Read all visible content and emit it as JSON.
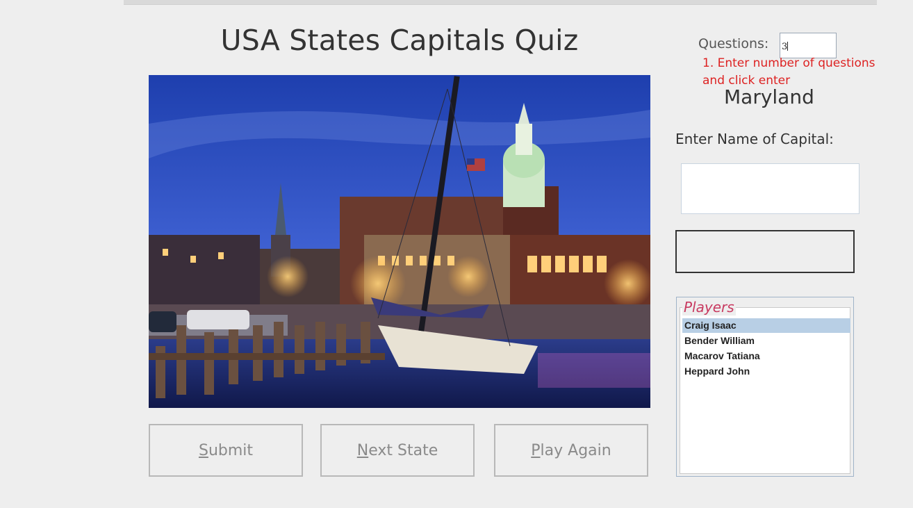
{
  "window": {
    "title": "USA States Capitals Quiz"
  },
  "questions": {
    "label": "Questions:",
    "value": "3"
  },
  "hint": "1. Enter number of questions and click enter",
  "current_state": "Maryland",
  "capital": {
    "label": "Enter Name of Capital:",
    "value": ""
  },
  "result_text": "",
  "players": {
    "title": "Players",
    "items": [
      "Craig Isaac",
      "Bender William",
      "Macarov Tatiana",
      "Heppard John"
    ],
    "selected": "Craig Isaac"
  },
  "buttons": {
    "submit": {
      "mnemonic": "S",
      "rest": "ubmit"
    },
    "next": {
      "mnemonic": "N",
      "rest": "ext State"
    },
    "play_again": {
      "mnemonic": "P",
      "rest": "lay Again"
    }
  },
  "image": {
    "subject": "state-capital-harbor-night-photo"
  },
  "colors": {
    "hint": "#dd2222",
    "players_title": "#c83a60",
    "selection": "#b8cfe5",
    "disabled_text": "#8a8a8a"
  }
}
